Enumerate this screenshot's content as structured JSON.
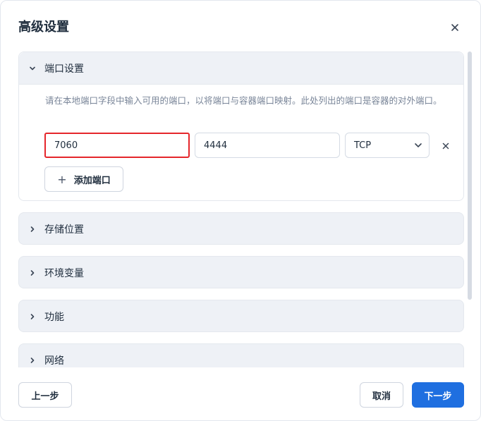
{
  "dialog": {
    "title": "高级设置",
    "close_icon": "close-icon"
  },
  "sections": {
    "ports": {
      "label": "端口设置",
      "expanded": true,
      "description": "请在本地端口字段中输入可用的端口，以将端口与容器端口映射。此处列出的端口是容器的对外端口。",
      "row": {
        "local_port": "7060",
        "container_port": "4444",
        "protocol": "TCP"
      },
      "add_port_label": "添加端口"
    },
    "storage": {
      "label": "存储位置"
    },
    "env": {
      "label": "环境变量"
    },
    "features": {
      "label": "功能"
    },
    "network": {
      "label": "网络"
    }
  },
  "footer": {
    "prev_label": "上一步",
    "cancel_label": "取消",
    "next_label": "下一步"
  },
  "colors": {
    "primary": "#1f6fe0",
    "highlight_border": "#e5262b",
    "panel_bg": "#eef1f6"
  }
}
